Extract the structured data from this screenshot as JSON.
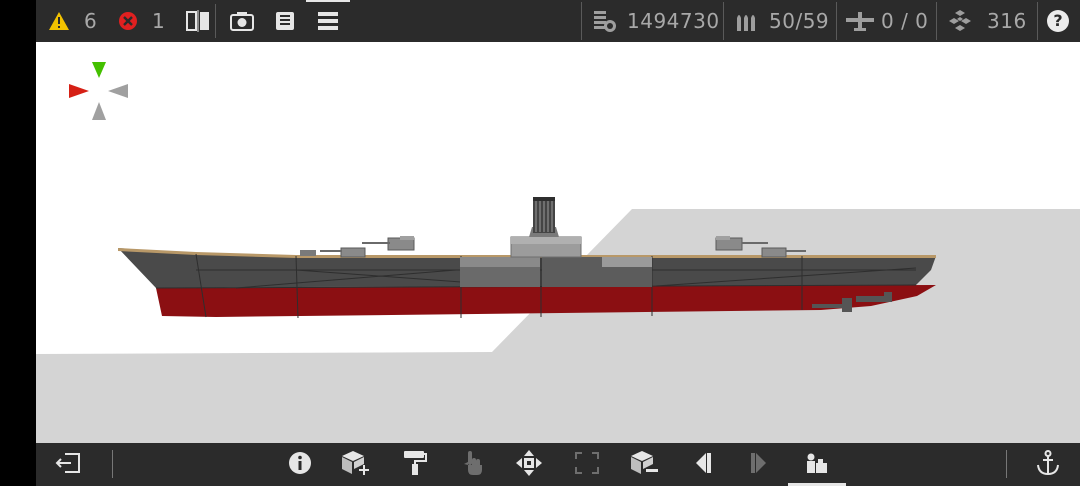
{
  "topbar": {
    "warnings": {
      "icon": "warning-icon",
      "count": "6",
      "color": "#f2c200"
    },
    "errors": {
      "icon": "error-icon",
      "count": "1",
      "color": "#e02020"
    },
    "tools": [
      {
        "name": "mirror-view-icon"
      },
      {
        "name": "camera-icon"
      },
      {
        "name": "save-icon"
      },
      {
        "name": "menu-icon"
      }
    ],
    "stats": {
      "cost": {
        "icon": "coins-icon",
        "value": "1494730"
      },
      "ammo": {
        "icon": "ammo-icon",
        "value": "50/59"
      },
      "aircraft": {
        "icon": "aircraft-icon",
        "value": "0 / 0"
      },
      "parts": {
        "icon": "parts-icon",
        "value": "316"
      }
    },
    "help": {
      "icon": "help-icon",
      "label": "?"
    }
  },
  "bottombar": {
    "exit": {
      "icon": "exit-icon"
    },
    "tools": [
      {
        "name": "info-icon"
      },
      {
        "name": "add-block-icon"
      },
      {
        "name": "paint-roller-icon"
      },
      {
        "name": "hand-select-icon"
      },
      {
        "name": "move-icon"
      },
      {
        "name": "resize-icon"
      },
      {
        "name": "block-edit-icon"
      },
      {
        "name": "step-back-icon"
      },
      {
        "name": "step-forward-icon"
      },
      {
        "name": "crew-icon",
        "active": true
      }
    ],
    "anchor": {
      "icon": "anchor-icon"
    }
  },
  "scene": {
    "sky_color": "#ffffff",
    "ground_color": "#d4d4d4",
    "hull_upper_color": "#4a4a4a",
    "hull_lower_color": "#8b0f12",
    "deck_color": "#b89868",
    "gizmo": {
      "up": "#44c000",
      "left": "#d62015",
      "other": "#a0a0a0"
    }
  }
}
